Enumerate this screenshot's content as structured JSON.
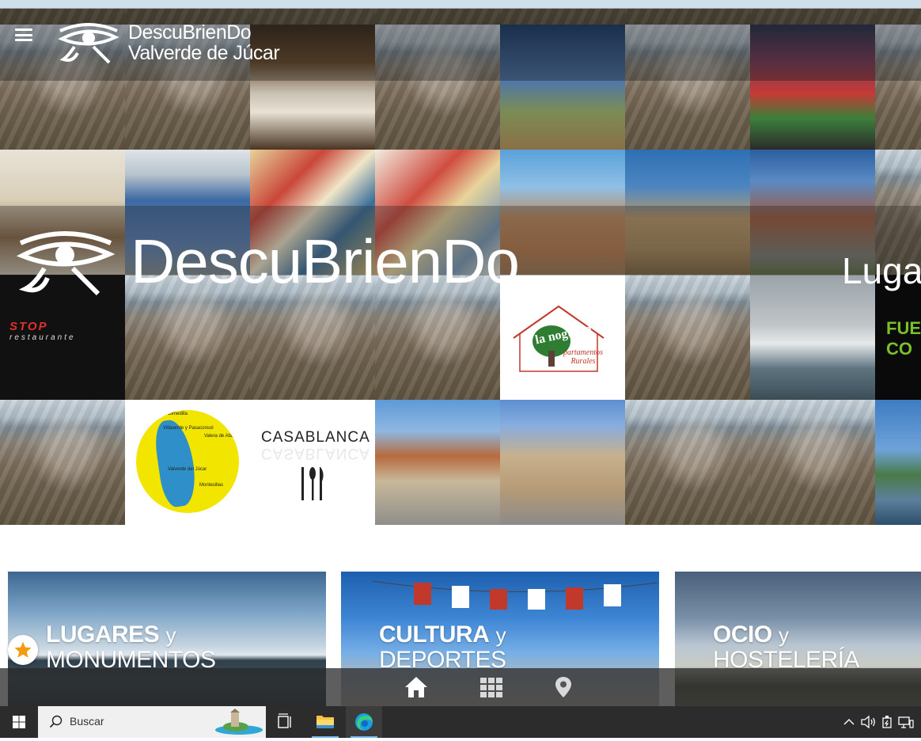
{
  "header": {
    "logo_line1": "DescuBrienDo",
    "logo_line2": "Valverde de Júcar",
    "menu_icon": "hamburger-icon"
  },
  "hero": {
    "title": "DescuBrienDo",
    "right_text": "Luga"
  },
  "mosaic": {
    "stop_name": "STOP",
    "stop_sub": "restaurante",
    "noguera_name": "la noguera",
    "noguera_sub_line1": "partamentos",
    "noguera_sub_line2": "Rurales",
    "fue_line1": "FUE",
    "fue_line2": "CO",
    "casablanca": "CASABLANCA",
    "map_labels": [
      "Villaverde y Pasaconsol",
      "Valera de Abajo",
      "Valverde del Júcar",
      "Montesillas",
      "Olmedilla"
    ]
  },
  "cards": [
    {
      "bold": "LUGARES",
      "y": "y",
      "sub": "MONUMENTOS"
    },
    {
      "bold": "CULTURA",
      "y": "y",
      "sub": "DEPORTES"
    },
    {
      "bold": "OCIO",
      "y": "y",
      "sub": "HOSTELERÍA"
    }
  ],
  "bottom_nav": [
    "home-icon",
    "grid-icon",
    "location-pin-icon"
  ],
  "taskbar": {
    "search_placeholder": "Buscar",
    "accent": "#76b9ed"
  }
}
